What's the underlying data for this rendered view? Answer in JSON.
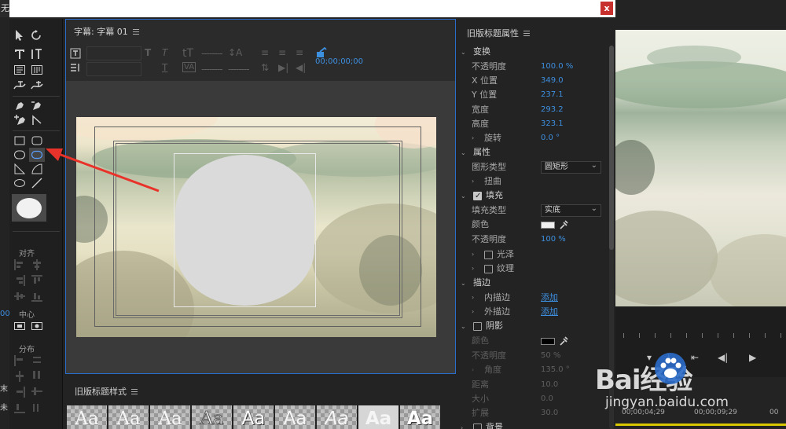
{
  "background": {
    "left_title_fragment": "无",
    "left_labels": [
      "00",
      "末",
      "未"
    ],
    "timeline_times": [
      "00;00;04;29",
      "00;00;09;29",
      "00"
    ],
    "watermark": {
      "brand": "Bai经验",
      "url": "jingyan.baidu.com"
    }
  },
  "dialog": {
    "close_label": "x",
    "editor": {
      "title": "字幕: 字幕 01",
      "timecode": "00;00;00;00"
    },
    "tools_panel": {
      "align_label": "对齐",
      "center_label": "中心",
      "distribute_label": "分布"
    },
    "styles_panel": {
      "title": "旧版标题样式",
      "swatches": [
        "Aa",
        "Aa",
        "Aa",
        "Aa",
        "Aa",
        "Aa",
        "Aa",
        "Aa",
        "Aa"
      ]
    },
    "properties": {
      "title": "旧版标题属性",
      "transform": {
        "label": "变换",
        "opacity_label": "不透明度",
        "opacity_value": "100.0 %",
        "x_label": "X 位置",
        "x_value": "349.0",
        "y_label": "Y 位置",
        "y_value": "237.1",
        "width_label": "宽度",
        "width_value": "293.2",
        "height_label": "高度",
        "height_value": "323.1",
        "rotation_label": "旋转",
        "rotation_value": "0.0 °"
      },
      "attributes": {
        "label": "属性",
        "shape_type_label": "图形类型",
        "shape_type_value": "圆矩形",
        "distort_label": "扭曲"
      },
      "fill": {
        "label": "填充",
        "fill_type_label": "填充类型",
        "fill_type_value": "实底",
        "color_label": "颜色",
        "color_value": "#f0f0f0",
        "opacity_label": "不透明度",
        "opacity_value": "100 %",
        "sheen_label": "光泽",
        "texture_label": "纹理"
      },
      "stroke": {
        "label": "描边",
        "inner_label": "内描边",
        "inner_action": "添加",
        "outer_label": "外描边",
        "outer_action": "添加"
      },
      "shadow": {
        "label": "阴影",
        "color_label": "颜色",
        "color_value": "#000000",
        "opacity_label": "不透明度",
        "opacity_value": "50 %",
        "angle_label": "角度",
        "angle_value": "135.0 °",
        "distance_label": "距离",
        "distance_value": "10.0",
        "size_label": "大小",
        "size_value": "0.0",
        "spread_label": "扩展",
        "spread_value": "30.0"
      },
      "background_label": "背景"
    }
  },
  "colors": {
    "accent": "#3d8fe0",
    "selection_border": "#2b6dcb",
    "close": "#c8302e",
    "arrow": "#e8322a"
  }
}
